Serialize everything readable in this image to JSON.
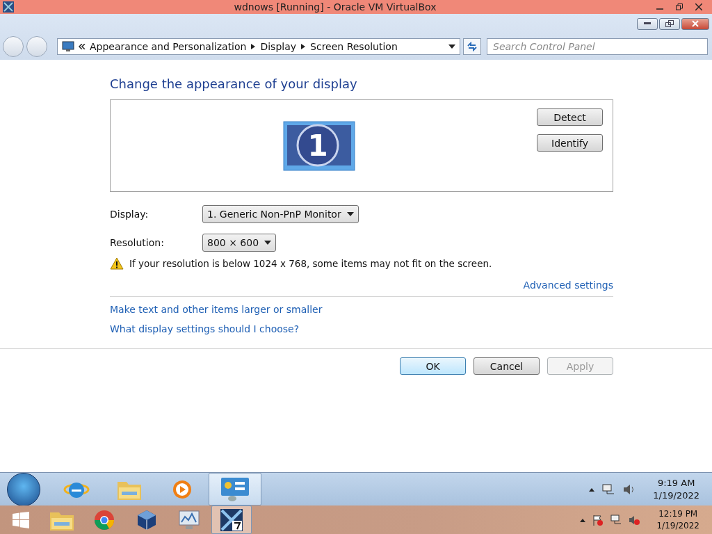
{
  "host_window": {
    "title": "wdnows [Running] - Oracle VM VirtualBox"
  },
  "address_bar": {
    "breadcrumbs": [
      "Appearance and Personalization",
      "Display",
      "Screen Resolution"
    ]
  },
  "search": {
    "placeholder": "Search Control Panel"
  },
  "heading": "Change the appearance of your display",
  "monitor": {
    "number": "1"
  },
  "monitor_buttons": [
    "Detect",
    "Identify"
  ],
  "fields": [
    {
      "label": "Display:",
      "value": "1. Generic Non-PnP Monitor"
    },
    {
      "label": "Resolution:",
      "value": "800 × 600"
    }
  ],
  "warning": "If your resolution is below 1024 x 768, some items may not fit on the screen.",
  "advanced_link": "Advanced settings",
  "links": [
    "Make text and other items larger or smaller",
    "What display settings should I choose?"
  ],
  "buttons": [
    {
      "label": "OK",
      "default": true,
      "disabled": false
    },
    {
      "label": "Cancel",
      "default": false,
      "disabled": false
    },
    {
      "label": "Apply",
      "default": false,
      "disabled": true
    }
  ],
  "guest_taskbar": {
    "items": [
      {
        "kind": "browser",
        "selected": false
      },
      {
        "kind": "folder",
        "selected": false
      },
      {
        "kind": "media",
        "selected": false
      },
      {
        "kind": "display",
        "selected": true
      }
    ],
    "time": "9:19 AM",
    "date": "1/19/2022"
  },
  "host_taskbar": {
    "items": [
      {
        "kind": "folder",
        "selected": false
      },
      {
        "kind": "chrome",
        "selected": false
      },
      {
        "kind": "cube",
        "selected": false
      },
      {
        "kind": "monitor",
        "selected": false
      },
      {
        "kind": "vm",
        "selected": true
      }
    ],
    "time": "12:19 PM",
    "date": "1/19/2022"
  }
}
